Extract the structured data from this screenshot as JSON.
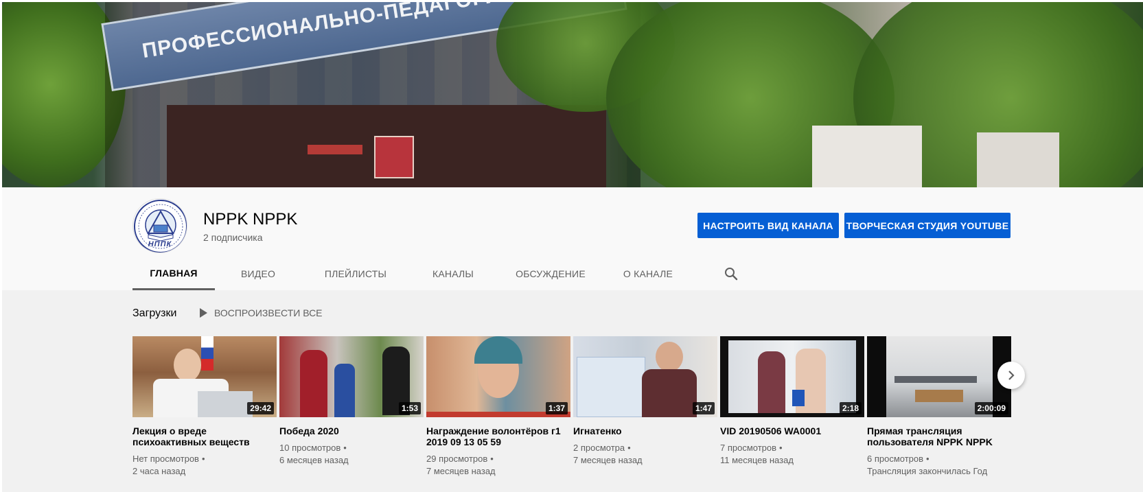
{
  "banner": {
    "sign_text": "ПРОФЕССИОНАЛЬНО-ПЕДАГОГИЧЕСКИЙ КОЛЛЕДЖ"
  },
  "channel": {
    "title": "NPPK NPPK",
    "subscribers": "2 подписчика",
    "avatar_text": "НППК",
    "customize_button": "НАСТРОИТЬ ВИД КАНАЛА",
    "studio_button": "ТВОРЧЕСКАЯ СТУДИЯ YOUTUBE"
  },
  "tabs": [
    {
      "label": "ГЛАВНАЯ",
      "active": true
    },
    {
      "label": "ВИДЕО"
    },
    {
      "label": "ПЛЕЙЛИСТЫ"
    },
    {
      "label": "КАНАЛЫ"
    },
    {
      "label": "ОБСУЖДЕНИЕ"
    },
    {
      "label": "О КАНАЛЕ"
    }
  ],
  "shelf": {
    "title": "Загрузки",
    "play_all": "ВОСПРОИЗВЕСТИ ВСЕ"
  },
  "videos": [
    {
      "title": "Лекция о вреде психоактивных веществ",
      "duration": "29:42",
      "views": "Нет просмотров",
      "age": "2 часа назад"
    },
    {
      "title": "Победа 2020",
      "duration": "1:53",
      "views": "10 просмотров",
      "age": "6 месяцев назад"
    },
    {
      "title": "Награждение волонтёров г1 2019 09 13 05 59",
      "duration": "1:37",
      "views": "29 просмотров",
      "age": "7 месяцев назад"
    },
    {
      "title": "Игнатенко",
      "duration": "1:47",
      "views": "2 просмотра",
      "age": "7 месяцев назад"
    },
    {
      "title": "VID 20190506 WA0001",
      "duration": "2:18",
      "views": "7 просмотров",
      "age": "11 месяцев назад"
    },
    {
      "title": "Прямая трансляция пользователя NPPK NPPK",
      "duration": "2:00:09",
      "views": "6 просмотров",
      "age": "Трансляция закончилась Год"
    }
  ],
  "colors": {
    "accent": "#065fd4",
    "header_bg": "#f9f9f9",
    "content_bg": "#f1f1f1"
  }
}
